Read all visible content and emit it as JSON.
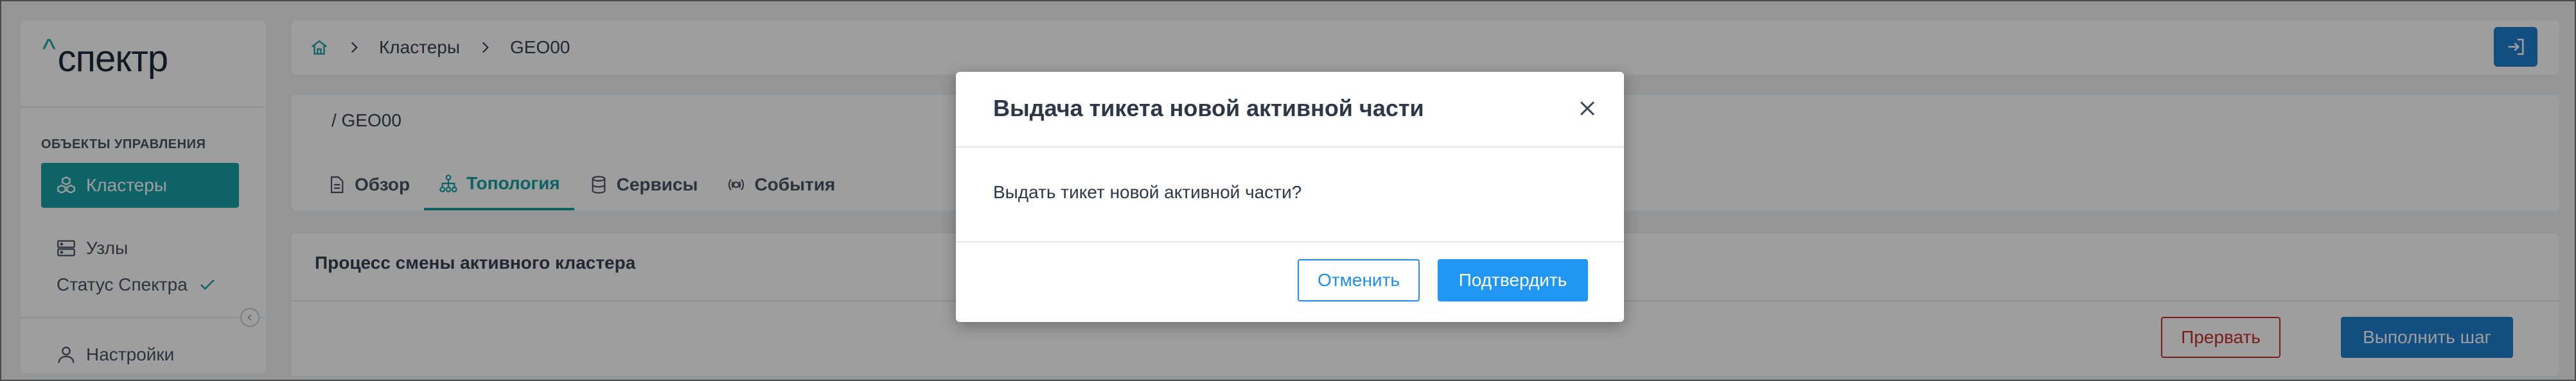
{
  "app": {
    "logo_caret": "^",
    "logo_text": "спектр"
  },
  "sidebar": {
    "section_title": "ОБЪЕКТЫ УПРАВЛЕНИЯ",
    "items": [
      {
        "label": "Кластеры",
        "icon": "clusters-icon",
        "active": true
      },
      {
        "label": "Узлы",
        "icon": "server-icon",
        "active": false
      }
    ],
    "status_label": "Статус Спектра",
    "settings_label": "Настройки"
  },
  "header": {
    "breadcrumb": [
      "Кластеры",
      "GEO00"
    ]
  },
  "main": {
    "page_title": "/  GEO00",
    "tabs": [
      {
        "label": "Обзор",
        "icon": "document-icon"
      },
      {
        "label": "Топология",
        "icon": "topology-icon",
        "active": true
      },
      {
        "label": "Сервисы",
        "icon": "database-icon"
      },
      {
        "label": "События",
        "icon": "events-icon"
      }
    ]
  },
  "process": {
    "title": "Процесс смены активного кластера",
    "abort_label": "Прервать",
    "step_label": "Выполнить шаг"
  },
  "modal": {
    "title": "Выдача тикета новой активной части",
    "body": "Выдать тикет новой активной части?",
    "cancel_label": "Отменить",
    "confirm_label": "Подтвердить"
  },
  "colors": {
    "accent": "#18a0a6",
    "primary": "#2196f3",
    "danger": "#c53030"
  }
}
